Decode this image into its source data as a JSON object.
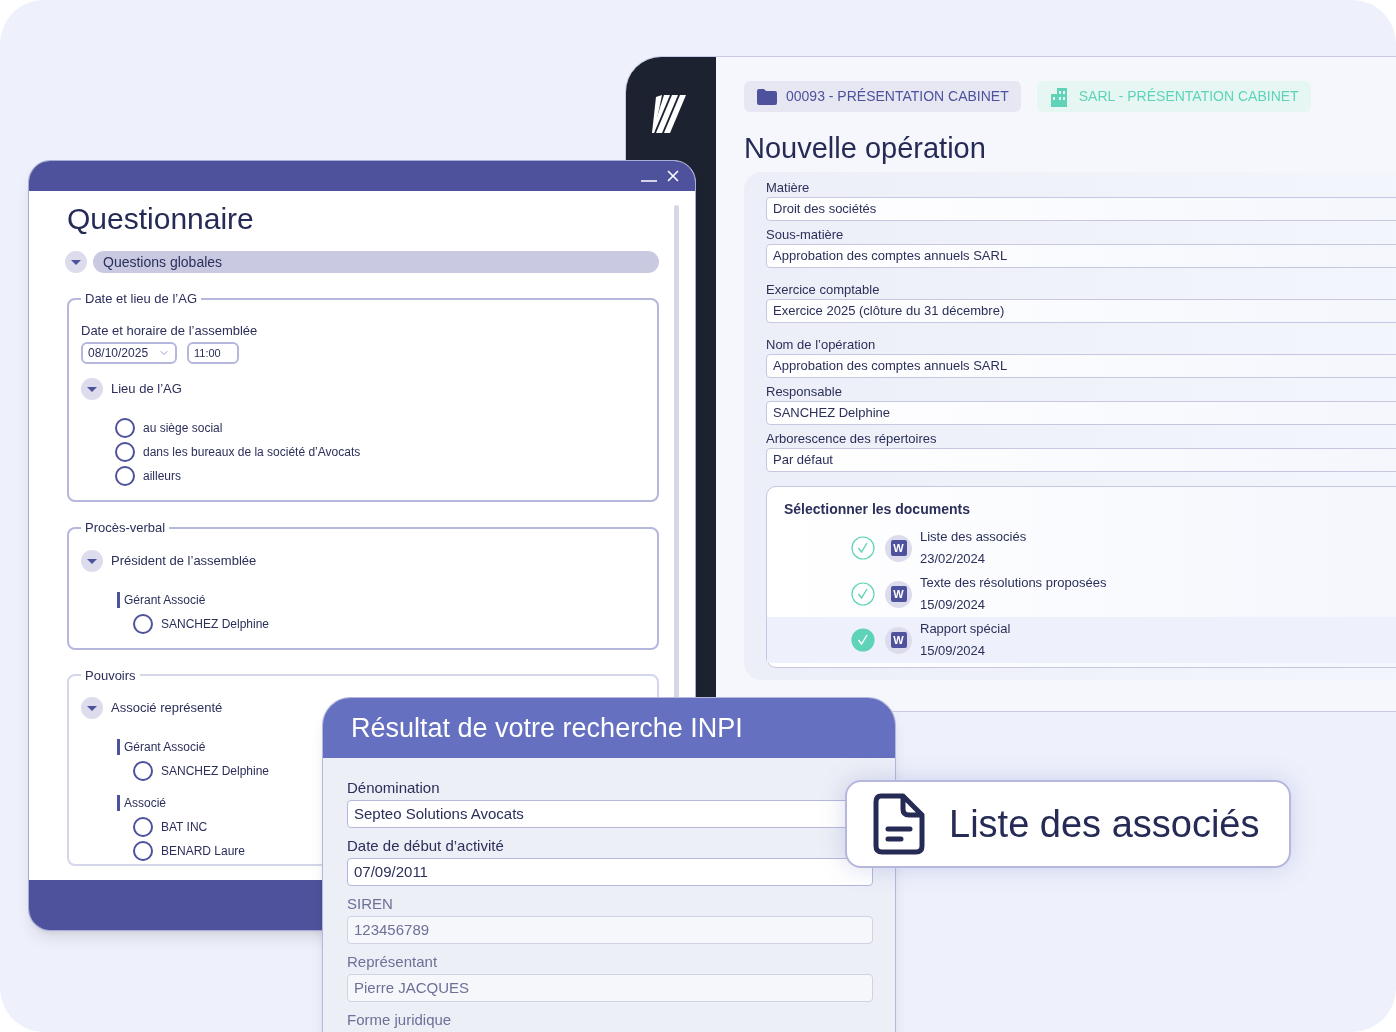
{
  "operation_window": {
    "breadcrumbs": [
      {
        "kind": "folder",
        "label": "00093 - PRÉSENTATION CABINET"
      },
      {
        "kind": "company",
        "label": "SARL - PRÉSENTATION CABINET"
      }
    ],
    "title": "Nouvelle opération",
    "fields": [
      {
        "label": "Matière",
        "value": "Droit des sociétés"
      },
      {
        "label": "Sous-matière",
        "value": "Approbation des comptes annuels SARL"
      },
      {
        "label": "Exercice comptable",
        "value": "Exercice 2025 (clôture du 31 décembre)"
      },
      {
        "label": "Nom de l’opération",
        "value": "Approbation des comptes annuels SARL"
      },
      {
        "label": "Responsable",
        "value": "SANCHEZ Delphine"
      },
      {
        "label": "Arborescence des répertoires",
        "value": "Par défaut"
      }
    ],
    "documents": {
      "title": "Sélectionner les documents",
      "items": [
        {
          "name": "Liste des associés",
          "date": "23/02/2024",
          "badge": "W",
          "selected": false
        },
        {
          "name": "Texte des résolutions proposées",
          "date": "15/09/2024",
          "badge": "W",
          "selected": false
        },
        {
          "name": "Rapport spécial",
          "date": "15/09/2024",
          "badge": "W",
          "selected": true
        }
      ]
    }
  },
  "questionnaire": {
    "title": "Questionnaire",
    "section": {
      "label": "Questions globales",
      "expanded": true
    },
    "groups": [
      {
        "legend": "Date et lieu de l’AG",
        "datetime": {
          "label": "Date et horaire de l’assemblée",
          "date": "08/10/2025",
          "time": "11:00"
        },
        "questions": [
          {
            "label": "Lieu de l’AG",
            "expanded": true,
            "options": [
              {
                "label": "au siège social",
                "checked": false
              },
              {
                "label": "dans les bureaux de la société d’Avocats",
                "checked": false
              },
              {
                "label": "ailleurs",
                "checked": false
              }
            ]
          }
        ]
      },
      {
        "legend": "Procès-verbal",
        "questions": [
          {
            "label": "Président de l’assemblée",
            "expanded": true,
            "roles": [
              {
                "label": "Gérant Associé",
                "options": [
                  {
                    "label": "SANCHEZ Delphine",
                    "checked": false
                  }
                ]
              }
            ]
          }
        ]
      },
      {
        "legend": "Pouvoirs",
        "questions": [
          {
            "label": "Associé représenté",
            "expanded": true,
            "roles": [
              {
                "label": "Gérant Associé",
                "options": [
                  {
                    "label": "SANCHEZ Delphine",
                    "checked": false
                  }
                ]
              },
              {
                "label": "Associé",
                "options": [
                  {
                    "label": "BAT INC",
                    "checked": false
                  },
                  {
                    "label": "BENARD Laure",
                    "checked": false
                  }
                ]
              }
            ]
          }
        ]
      }
    ]
  },
  "inpi_window": {
    "title": "Résultat de votre recherche INPI",
    "fields": [
      {
        "label": "Dénomination",
        "value": "Septeo Solutions Avocats"
      },
      {
        "label": "Date de début d’activité",
        "value": "07/09/2011"
      },
      {
        "label": "SIREN",
        "value": "123456789"
      },
      {
        "label": "Représentant",
        "value": "Pierre JACQUES"
      },
      {
        "label": "Forme juridique"
      }
    ]
  },
  "toast": {
    "label": "Liste des associés"
  }
}
